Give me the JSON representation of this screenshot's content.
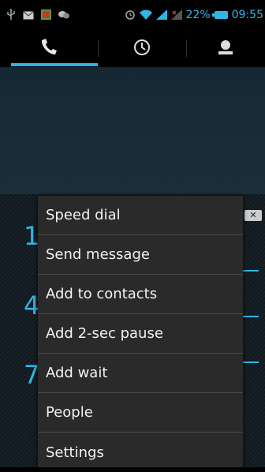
{
  "status_bar": {
    "battery_percent": "22%",
    "time": "09:55",
    "icons": [
      "usb-icon",
      "mail-icon",
      "picture-icon",
      "wechat-icon",
      "alarm-icon",
      "wifi-icon",
      "signal-icon",
      "no-signal-icon",
      "battery-icon"
    ]
  },
  "tabs": [
    {
      "icon": "phone-icon",
      "selected": true
    },
    {
      "icon": "clock-icon",
      "selected": false
    },
    {
      "icon": "contact-icon",
      "selected": false
    }
  ],
  "dialpad_visible_digits": [
    "1",
    "4",
    "7"
  ],
  "menu": {
    "items": [
      {
        "label": "Speed dial"
      },
      {
        "label": "Send message"
      },
      {
        "label": "Add to contacts"
      },
      {
        "label": "Add 2-sec pause"
      },
      {
        "label": "Add wait"
      },
      {
        "label": "People"
      },
      {
        "label": "Settings"
      }
    ]
  },
  "colors": {
    "accent": "#33b5e5",
    "menu_bg": "#2a2a2a"
  }
}
